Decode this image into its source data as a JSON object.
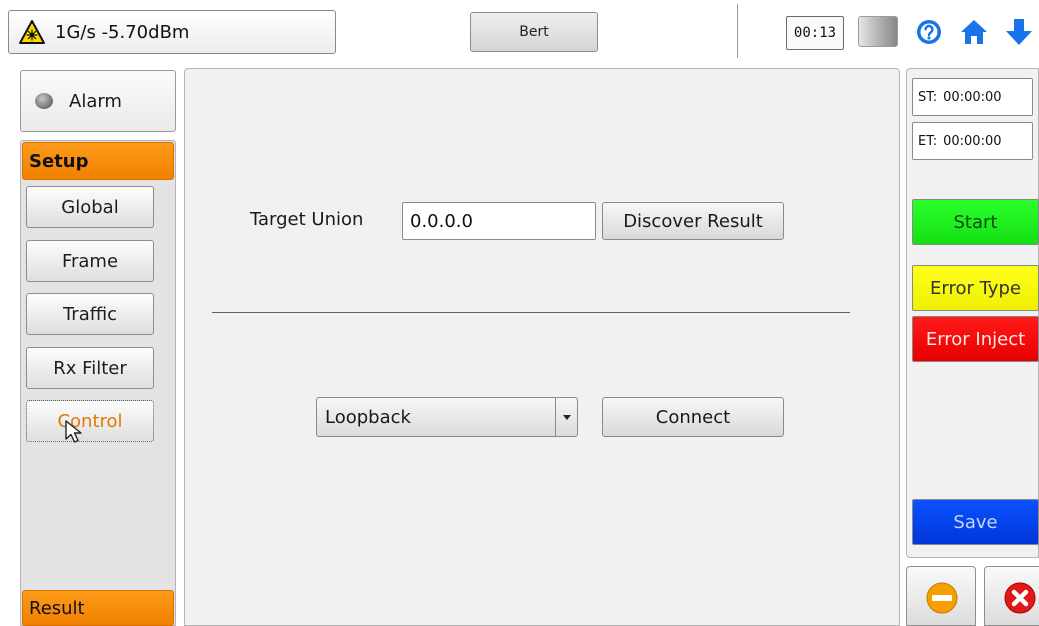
{
  "topbar": {
    "laser_status": "1G/s -5.70dBm",
    "mode_label": "Bert",
    "timer": "00:13",
    "icons": [
      "laser-warning-icon",
      "battery-icon",
      "help-icon",
      "home-icon",
      "down-arrow-icon"
    ]
  },
  "sidebar": {
    "alarm_label": "Alarm",
    "setup_header": "Setup",
    "items": [
      {
        "label": "Global"
      },
      {
        "label": "Frame"
      },
      {
        "label": "Traffic"
      },
      {
        "label": "Rx Filter"
      },
      {
        "label": "Control",
        "active": true
      }
    ],
    "result_header": "Result"
  },
  "main": {
    "target_union_label": "Target Union",
    "target_union_value": "0.0.0.0",
    "discover_button": "Discover Result",
    "loopback_select": {
      "selected": "Loopback"
    },
    "connect_button": "Connect"
  },
  "right_panel": {
    "start_time_label": "ST:",
    "start_time": "00:00:00",
    "end_time_label": "ET:",
    "end_time": "00:00:00",
    "start_button": "Start",
    "error_type_button": "Error Type",
    "error_inject_button": "Error Inject",
    "save_button": "Save"
  },
  "colors": {
    "accent_orange": "#f08000",
    "start_green": "#14e014",
    "error_type_yellow": "#f0f000",
    "error_inject_red": "#e60000",
    "save_blue": "#0036d9",
    "icon_blue": "#1a73e8",
    "close_red": "#e01818"
  }
}
